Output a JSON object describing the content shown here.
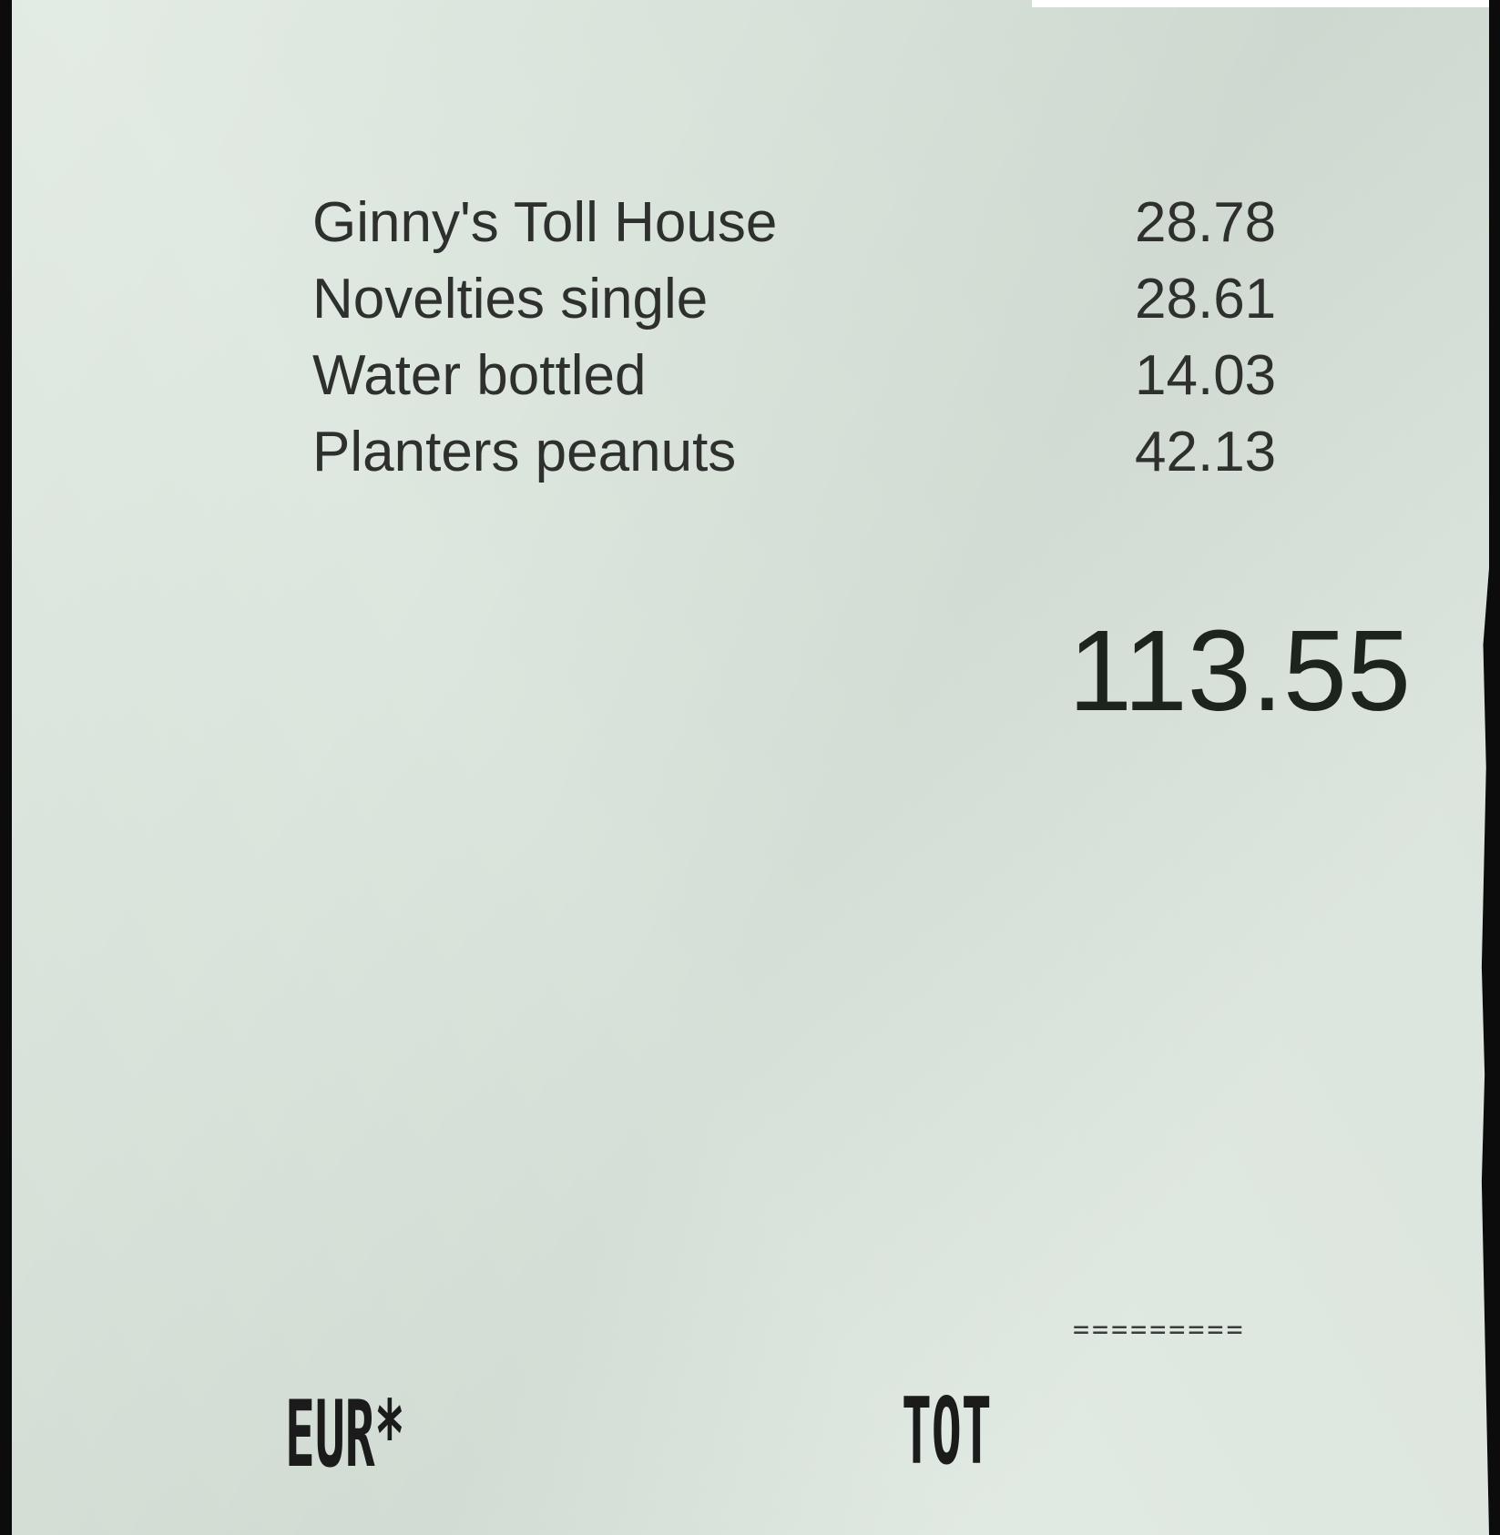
{
  "receipt": {
    "items": [
      {
        "name": "Ginny's Toll House",
        "price": "28.78"
      },
      {
        "name": "Novelties single",
        "price": "28.61"
      },
      {
        "name": "Water bottled",
        "price": "14.03"
      },
      {
        "name": "Planters peanuts",
        "price": "42.13"
      }
    ],
    "total": "113.55",
    "separator": "=========",
    "currency": "EUR*",
    "total_label": "TOT"
  },
  "colors": {
    "paper": "#dae5dc",
    "ink": "#2e302e",
    "background": "#0c0c0c"
  }
}
